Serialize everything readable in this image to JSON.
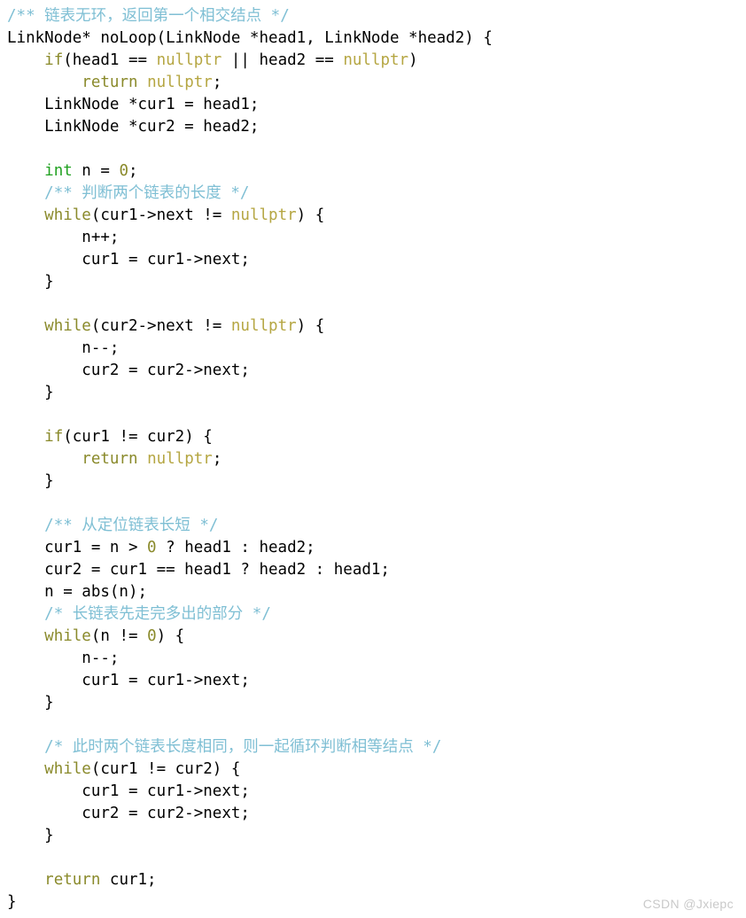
{
  "document": {
    "kind": "code-listing",
    "language": "C++",
    "background_color": "#ffffff",
    "colors": {
      "plain": "#000000",
      "comment": "#7fbfd4",
      "keyword": "#8a8a2b",
      "type": "#21a121",
      "constant": "#b5a642",
      "number": "#8a8a2b",
      "watermark": "#c9c9c9"
    }
  },
  "watermark": {
    "text": "CSDN @Jxiepc"
  },
  "code": {
    "lines": [
      {
        "index": 1,
        "text": "/** 链表无环，返回第一个相交结点 */",
        "tokens": [
          {
            "t": "/** 链表无环，返回第一个相交结点 */",
            "c": "t-comment"
          }
        ]
      },
      {
        "index": 2,
        "text": "LinkNode* noLoop(LinkNode *head1, LinkNode *head2) {",
        "tokens": [
          {
            "t": "LinkNode* noLoop(LinkNode *head1, LinkNode *head2) {",
            "c": "t-plain"
          }
        ]
      },
      {
        "index": 3,
        "text": "    if(head1 == nullptr || head2 == nullptr)",
        "tokens": [
          {
            "t": "    ",
            "c": "t-plain"
          },
          {
            "t": "if",
            "c": "t-keyword"
          },
          {
            "t": "(head1 == ",
            "c": "t-plain"
          },
          {
            "t": "nullptr",
            "c": "t-const"
          },
          {
            "t": " || head2 == ",
            "c": "t-plain"
          },
          {
            "t": "nullptr",
            "c": "t-const"
          },
          {
            "t": ")",
            "c": "t-plain"
          }
        ]
      },
      {
        "index": 4,
        "text": "        return nullptr;",
        "tokens": [
          {
            "t": "        ",
            "c": "t-plain"
          },
          {
            "t": "return",
            "c": "t-keyword"
          },
          {
            "t": " ",
            "c": "t-plain"
          },
          {
            "t": "nullptr",
            "c": "t-const"
          },
          {
            "t": ";",
            "c": "t-plain"
          }
        ]
      },
      {
        "index": 5,
        "text": "    LinkNode *cur1 = head1;",
        "tokens": [
          {
            "t": "    LinkNode *cur1 = head1;",
            "c": "t-plain"
          }
        ]
      },
      {
        "index": 6,
        "text": "    LinkNode *cur2 = head2;",
        "tokens": [
          {
            "t": "    LinkNode *cur2 = head2;",
            "c": "t-plain"
          }
        ]
      },
      {
        "index": 7,
        "text": "",
        "tokens": []
      },
      {
        "index": 8,
        "text": "    int n = 0;",
        "tokens": [
          {
            "t": "    ",
            "c": "t-plain"
          },
          {
            "t": "int",
            "c": "t-type"
          },
          {
            "t": " n = ",
            "c": "t-plain"
          },
          {
            "t": "0",
            "c": "t-number"
          },
          {
            "t": ";",
            "c": "t-plain"
          }
        ]
      },
      {
        "index": 9,
        "text": "    /** 判断两个链表的长度 */",
        "tokens": [
          {
            "t": "    ",
            "c": "t-plain"
          },
          {
            "t": "/** 判断两个链表的长度 */",
            "c": "t-comment"
          }
        ]
      },
      {
        "index": 10,
        "text": "    while(cur1->next != nullptr) {",
        "tokens": [
          {
            "t": "    ",
            "c": "t-plain"
          },
          {
            "t": "while",
            "c": "t-keyword"
          },
          {
            "t": "(cur1->next != ",
            "c": "t-plain"
          },
          {
            "t": "nullptr",
            "c": "t-const"
          },
          {
            "t": ") {",
            "c": "t-plain"
          }
        ]
      },
      {
        "index": 11,
        "text": "        n++;",
        "tokens": [
          {
            "t": "        n++;",
            "c": "t-plain"
          }
        ]
      },
      {
        "index": 12,
        "text": "        cur1 = cur1->next;",
        "tokens": [
          {
            "t": "        cur1 = cur1->next;",
            "c": "t-plain"
          }
        ]
      },
      {
        "index": 13,
        "text": "    }",
        "tokens": [
          {
            "t": "    }",
            "c": "t-plain"
          }
        ]
      },
      {
        "index": 14,
        "text": "",
        "tokens": []
      },
      {
        "index": 15,
        "text": "    while(cur2->next != nullptr) {",
        "tokens": [
          {
            "t": "    ",
            "c": "t-plain"
          },
          {
            "t": "while",
            "c": "t-keyword"
          },
          {
            "t": "(cur2->next != ",
            "c": "t-plain"
          },
          {
            "t": "nullptr",
            "c": "t-const"
          },
          {
            "t": ") {",
            "c": "t-plain"
          }
        ]
      },
      {
        "index": 16,
        "text": "        n--;",
        "tokens": [
          {
            "t": "        n--;",
            "c": "t-plain"
          }
        ]
      },
      {
        "index": 17,
        "text": "        cur2 = cur2->next;",
        "tokens": [
          {
            "t": "        cur2 = cur2->next;",
            "c": "t-plain"
          }
        ]
      },
      {
        "index": 18,
        "text": "    }",
        "tokens": [
          {
            "t": "    }",
            "c": "t-plain"
          }
        ]
      },
      {
        "index": 19,
        "text": "",
        "tokens": []
      },
      {
        "index": 20,
        "text": "    if(cur1 != cur2) {",
        "tokens": [
          {
            "t": "    ",
            "c": "t-plain"
          },
          {
            "t": "if",
            "c": "t-keyword"
          },
          {
            "t": "(cur1 != cur2) {",
            "c": "t-plain"
          }
        ]
      },
      {
        "index": 21,
        "text": "        return nullptr;",
        "tokens": [
          {
            "t": "        ",
            "c": "t-plain"
          },
          {
            "t": "return",
            "c": "t-keyword"
          },
          {
            "t": " ",
            "c": "t-plain"
          },
          {
            "t": "nullptr",
            "c": "t-const"
          },
          {
            "t": ";",
            "c": "t-plain"
          }
        ]
      },
      {
        "index": 22,
        "text": "    }",
        "tokens": [
          {
            "t": "    }",
            "c": "t-plain"
          }
        ]
      },
      {
        "index": 23,
        "text": "",
        "tokens": []
      },
      {
        "index": 24,
        "text": "    /** 从定位链表长短 */",
        "tokens": [
          {
            "t": "    ",
            "c": "t-plain"
          },
          {
            "t": "/** 从定位链表长短 */",
            "c": "t-comment"
          }
        ]
      },
      {
        "index": 25,
        "text": "    cur1 = n > 0 ? head1 : head2;",
        "tokens": [
          {
            "t": "    cur1 = n > ",
            "c": "t-plain"
          },
          {
            "t": "0",
            "c": "t-number"
          },
          {
            "t": " ? head1 : head2;",
            "c": "t-plain"
          }
        ]
      },
      {
        "index": 26,
        "text": "    cur2 = cur1 == head1 ? head2 : head1;",
        "tokens": [
          {
            "t": "    cur2 = cur1 == head1 ? head2 : head1;",
            "c": "t-plain"
          }
        ]
      },
      {
        "index": 27,
        "text": "    n = abs(n);",
        "tokens": [
          {
            "t": "    n = abs(n);",
            "c": "t-plain"
          }
        ]
      },
      {
        "index": 28,
        "text": "    /* 长链表先走完多出的部分 */",
        "tokens": [
          {
            "t": "    ",
            "c": "t-plain"
          },
          {
            "t": "/* 长链表先走完多出的部分 */",
            "c": "t-comment"
          }
        ]
      },
      {
        "index": 29,
        "text": "    while(n != 0) {",
        "tokens": [
          {
            "t": "    ",
            "c": "t-plain"
          },
          {
            "t": "while",
            "c": "t-keyword"
          },
          {
            "t": "(n != ",
            "c": "t-plain"
          },
          {
            "t": "0",
            "c": "t-number"
          },
          {
            "t": ") {",
            "c": "t-plain"
          }
        ]
      },
      {
        "index": 30,
        "text": "        n--;",
        "tokens": [
          {
            "t": "        n--;",
            "c": "t-plain"
          }
        ]
      },
      {
        "index": 31,
        "text": "        cur1 = cur1->next;",
        "tokens": [
          {
            "t": "        cur1 = cur1->next;",
            "c": "t-plain"
          }
        ]
      },
      {
        "index": 32,
        "text": "    }",
        "tokens": [
          {
            "t": "    }",
            "c": "t-plain"
          }
        ]
      },
      {
        "index": 33,
        "text": "",
        "tokens": []
      },
      {
        "index": 34,
        "text": "    /* 此时两个链表长度相同，则一起循环判断相等结点 */",
        "tokens": [
          {
            "t": "    ",
            "c": "t-plain"
          },
          {
            "t": "/* 此时两个链表长度相同，则一起循环判断相等结点 */",
            "c": "t-comment"
          }
        ]
      },
      {
        "index": 35,
        "text": "    while(cur1 != cur2) {",
        "tokens": [
          {
            "t": "    ",
            "c": "t-plain"
          },
          {
            "t": "while",
            "c": "t-keyword"
          },
          {
            "t": "(cur1 != cur2) {",
            "c": "t-plain"
          }
        ]
      },
      {
        "index": 36,
        "text": "        cur1 = cur1->next;",
        "tokens": [
          {
            "t": "        cur1 = cur1->next;",
            "c": "t-plain"
          }
        ]
      },
      {
        "index": 37,
        "text": "        cur2 = cur2->next;",
        "tokens": [
          {
            "t": "        cur2 = cur2->next;",
            "c": "t-plain"
          }
        ]
      },
      {
        "index": 38,
        "text": "    }",
        "tokens": [
          {
            "t": "    }",
            "c": "t-plain"
          }
        ]
      },
      {
        "index": 39,
        "text": "",
        "tokens": []
      },
      {
        "index": 40,
        "text": "    return cur1;",
        "tokens": [
          {
            "t": "    ",
            "c": "t-plain"
          },
          {
            "t": "return",
            "c": "t-keyword"
          },
          {
            "t": " cur1;",
            "c": "t-plain"
          }
        ]
      },
      {
        "index": 41,
        "text": "}",
        "tokens": [
          {
            "t": "}",
            "c": "t-plain"
          }
        ]
      }
    ]
  }
}
